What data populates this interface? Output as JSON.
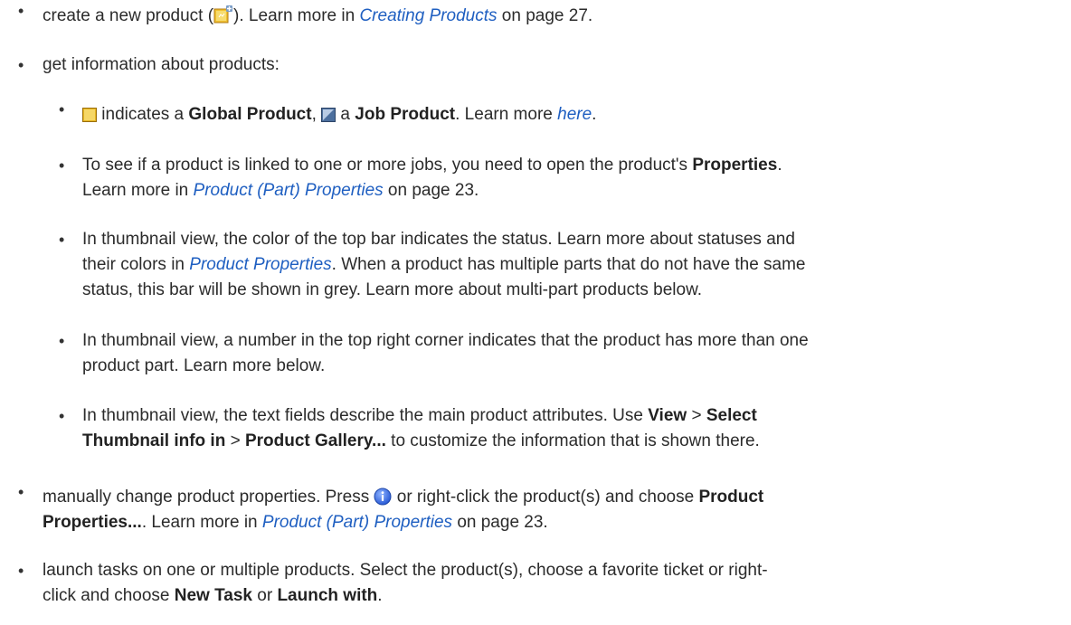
{
  "items": [
    {
      "t1": "create a new product (",
      "t2": "). Learn more in ",
      "link": "Creating Products",
      "t3": " on page 27."
    },
    {
      "t1": "get information about products:"
    },
    {
      "t1": " indicates a ",
      "b1": "Global Product",
      "t2": ", ",
      "t3": " a ",
      "b2": "Job Product",
      "t4": ". Learn more ",
      "link": "here",
      "t5": "."
    },
    {
      "t1": "To see if a product is linked to one or more jobs, you need to open the product's ",
      "b1": "Properties",
      "t2": ".",
      "t3": "Learn more in ",
      "link": "Product (Part) Properties",
      "t4": " on page 23."
    },
    {
      "l1": "In thumbnail view, the color of the top bar indicates the status. Learn more about statuses and",
      "l2a": "their colors in ",
      "link": "Product Properties",
      "l2b": ". When a product has multiple parts that do not have the same",
      "l3": "status, this bar will be shown in grey. Learn more about multi-part products below."
    },
    {
      "l1": "In thumbnail view, a number in the top right corner indicates that the product has more than one",
      "l2": "product part. Learn more below."
    },
    {
      "l1a": "In thumbnail view, the text fields describe the main product attributes. Use ",
      "b1": "View",
      "sep1": " > ",
      "b2": "Select",
      "b3": "Thumbnail info in",
      "sep2": " > ",
      "b4": "Product Gallery...",
      "l2b": " to customize the information that is shown there."
    },
    {
      "l1a": "manually change product properties. Press ",
      "l1b": " or right-click the product(s) and choose ",
      "b1": "Product",
      "b2": "Properties...",
      "l2a": ". Learn more in ",
      "link": "Product (Part) Properties",
      "l2b": " on page 23."
    },
    {
      "l1": "launch tasks on one or multiple products. Select the product(s), choose a favorite ticket or right-",
      "l2a": "click and choose ",
      "b1": "New Task",
      "l2b": " or ",
      "b2": "Launch with",
      "l2c": "."
    }
  ],
  "bullet_char": "•",
  "icons": {
    "new_product": "new-product-icon",
    "global_product": "global-product-icon",
    "job_product": "job-product-icon",
    "info": "info-icon"
  },
  "colors": {
    "link": "#1f5fc1",
    "text": "#2b2b2b"
  }
}
